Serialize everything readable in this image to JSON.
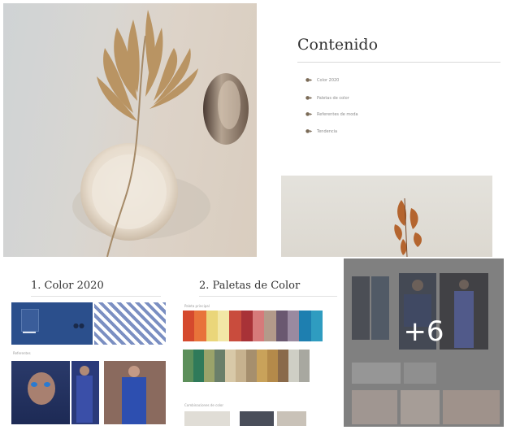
{
  "contents": {
    "title": "Contenido",
    "items": [
      "Color 2020",
      "Paletas de color",
      "Referentes de moda",
      "Tendencia"
    ]
  },
  "section_color": {
    "title": "1. Color 2020",
    "sub_label": "Referentes"
  },
  "section_palettes": {
    "title": "2. Paletas de Color",
    "label_top": "Paleta principal",
    "label_bottom": "Combinaciones de color",
    "row1": [
      "#d5492d",
      "#e8733a",
      "#ead67a",
      "#f2e7a6",
      "#c94c3d",
      "#a83237",
      "#d67a7a",
      "#b39a8a",
      "#6a5870",
      "#9a8aa0",
      "#1e7fb0",
      "#2f9cc0"
    ],
    "row2": [
      "#5c8f5a",
      "#2f7a5a",
      "#9aa36a",
      "#6a7f6a",
      "#d8c9a8",
      "#c7b28e",
      "#a68f6d",
      "#c9a25a",
      "#b48a4a",
      "#8a6a4a",
      "#cfcfc5",
      "#a8a8a0"
    ]
  },
  "more_overlay": {
    "count_text": "+6"
  },
  "colors": {
    "classic_blue": "#2b4f8c",
    "text_dark": "#333333",
    "overlay_bg": "#8e8e8e"
  }
}
